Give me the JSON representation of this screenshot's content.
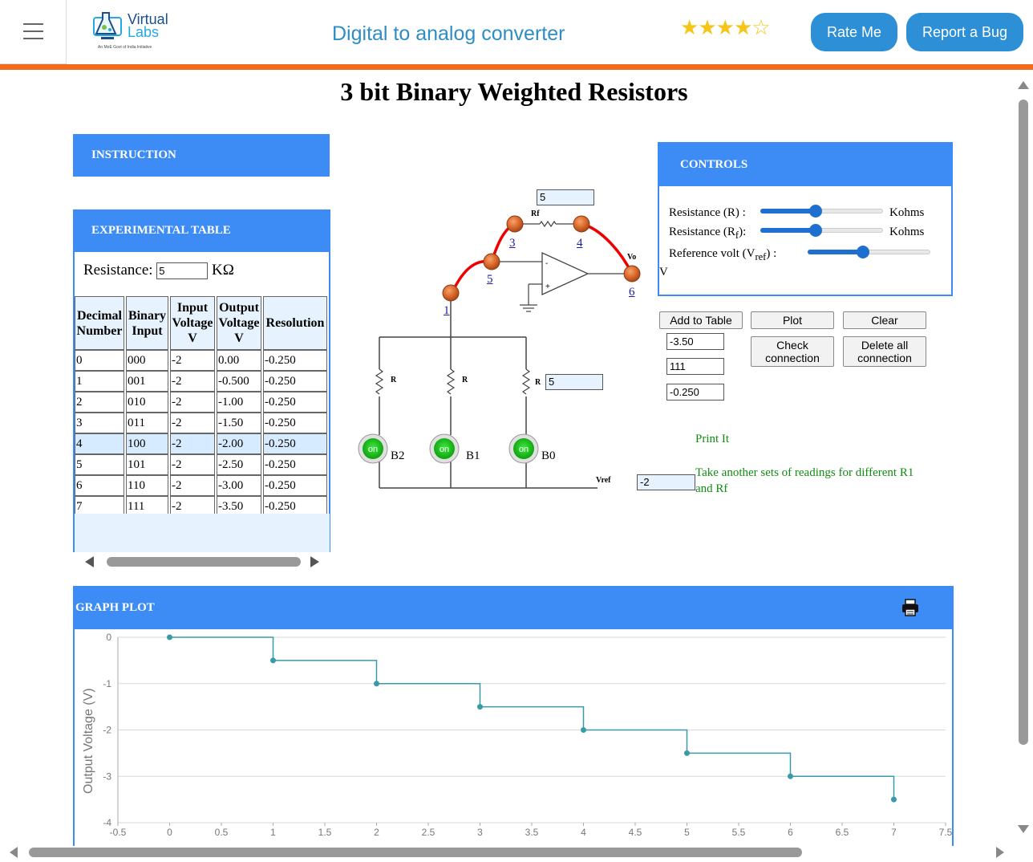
{
  "header": {
    "logo_line1": "Virtual",
    "logo_line2": "Labs",
    "logo_sub": "An MoE Govt of India Initiative",
    "app_title": "Digital to analog converter",
    "rating": 4,
    "rating_max": 5,
    "rate_button": "Rate Me",
    "report_button": "Report a Bug"
  },
  "page_title": "3 bit Binary Weighted Resistors",
  "instruction": {
    "title": "INSTRUCTION"
  },
  "experimental": {
    "title": "EXPERIMENTAL TABLE",
    "resistance_label": "Resistance:",
    "resistance_value": "5",
    "resistance_unit": "KΩ",
    "headers": [
      [
        "Decimal",
        "Number"
      ],
      [
        "Binary",
        "Input"
      ],
      [
        "Input",
        "Voltage",
        "V"
      ],
      [
        "Output",
        "Voltage",
        "V"
      ],
      [
        "Resolution"
      ]
    ],
    "rows": [
      [
        "0",
        "000",
        "-2",
        "0.00",
        "-0.250"
      ],
      [
        "1",
        "001",
        "-2",
        "-0.500",
        "-0.250"
      ],
      [
        "2",
        "010",
        "-2",
        "-1.00",
        "-0.250"
      ],
      [
        "3",
        "011",
        "-2",
        "-1.50",
        "-0.250"
      ],
      [
        "4",
        "100",
        "-2",
        "-2.00",
        "-0.250"
      ],
      [
        "5",
        "101",
        "-2",
        "-2.50",
        "-0.250"
      ],
      [
        "6",
        "110",
        "-2",
        "-3.00",
        "-0.250"
      ],
      [
        "7",
        "111",
        "-2",
        "-3.50",
        "-0.250"
      ]
    ],
    "highlighted_row": 4
  },
  "circuit": {
    "rf_value": "5",
    "rf_label": "Rf",
    "r_value": "5",
    "r_label": "R",
    "vo_label": "Vo",
    "vref_label": "Vref",
    "vref_value": "-2",
    "opamp_minus": "-",
    "opamp_plus": "+",
    "nodes": [
      "1",
      "3",
      "4",
      "5",
      "6"
    ],
    "switches": [
      {
        "label": "B2",
        "state": "on"
      },
      {
        "label": "B1",
        "state": "on"
      },
      {
        "label": "B0",
        "state": "on"
      }
    ]
  },
  "controls": {
    "title": "CONTROLS",
    "r_label": "Resistance (R) :",
    "r_unit": "Kohms",
    "r_level": 0.45,
    "rf_label": "Resistance (R",
    "rf_sub": "f",
    "rf_tail": "):",
    "rf_unit": "Kohms",
    "rf_level": 0.45,
    "vref_label": "Reference volt (V",
    "vref_sub": "ref",
    "vref_tail": ") :",
    "vref_unit": "V",
    "vref_level": 0.45
  },
  "buttons": {
    "add_to_table": "Add to Table",
    "plot": "Plot",
    "clear": "Clear",
    "check_connection": "Check connection",
    "delete_all": "Delete all connection"
  },
  "outputs": {
    "output_voltage": "-3.50",
    "binary": "111",
    "resolution": "-0.250"
  },
  "messages": {
    "print_it": "Print It",
    "take_another": "Take another sets of readings for different R1 and Rf"
  },
  "graph": {
    "title": "GRAPH PLOT",
    "print_icon": "printer-icon"
  },
  "chart_data": {
    "type": "line",
    "step": true,
    "x": [
      0,
      1,
      2,
      3,
      4,
      5,
      6,
      7
    ],
    "values": [
      0,
      -0.5,
      -1,
      -1.5,
      -2,
      -2.5,
      -3,
      -3.5
    ],
    "ylabel": "Output Voltage (V)",
    "xlabel": "",
    "xlim": [
      -0.5,
      7.5
    ],
    "ylim": [
      -4,
      0
    ],
    "x_ticks": [
      "-0.5",
      "0",
      "0.5",
      "1",
      "1.5",
      "2",
      "2.5",
      "3",
      "3.5",
      "4",
      "4.5",
      "5",
      "5.5",
      "6",
      "6.5",
      "7",
      "7.5"
    ],
    "y_ticks": [
      "0",
      "-1",
      "-2",
      "-3",
      "-4"
    ],
    "grid": true,
    "color": "#3a9aa8"
  }
}
